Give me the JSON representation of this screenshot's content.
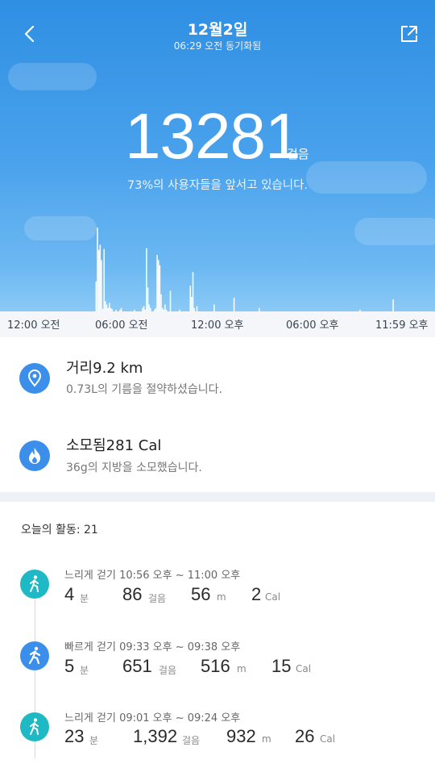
{
  "header": {
    "date": "12월2일",
    "sync_time": "06:29 오전 동기화됨"
  },
  "summary": {
    "steps": "13281",
    "steps_unit": "걸음",
    "rank_text": "73%의 사용자들을 앞서고 있습니다."
  },
  "chart_data": {
    "type": "bar",
    "x_range": [
      "12:00 오전",
      "11:59 오후"
    ],
    "tick_labels": [
      "12:00 오전",
      "06:00 오전",
      "12:00 오후",
      "06:00 오후",
      "11:59 오후"
    ],
    "ylim": [
      0,
      100
    ],
    "values": [
      0,
      0,
      0,
      0,
      0,
      0,
      0,
      0,
      0,
      0,
      0,
      0,
      0,
      0,
      0,
      0,
      0,
      0,
      0,
      0,
      0,
      0,
      0,
      0,
      0,
      0,
      0,
      0,
      0,
      0,
      0,
      0,
      0,
      0,
      0,
      0,
      0,
      0,
      0,
      0,
      0,
      0,
      0,
      0,
      0,
      0,
      0,
      0,
      0,
      0,
      0,
      0,
      0,
      0,
      0,
      0,
      0,
      0,
      0,
      0,
      0,
      0,
      0,
      0,
      0,
      0,
      0,
      0,
      0,
      0,
      0,
      0,
      35,
      98,
      72,
      78,
      60,
      3,
      73,
      12,
      8,
      4,
      10,
      4,
      3,
      0,
      0,
      2,
      0,
      0,
      2,
      4,
      0,
      0,
      0,
      0,
      0,
      0,
      0,
      0,
      0,
      2,
      0,
      0,
      0,
      0,
      0,
      4,
      6,
      2,
      74,
      28,
      8,
      4,
      0,
      0,
      2,
      4,
      66,
      60,
      54,
      20,
      4,
      2,
      8,
      2,
      0,
      0,
      24,
      0,
      0,
      0,
      0,
      0,
      0,
      2,
      0,
      0,
      0,
      0,
      0,
      0,
      0,
      30,
      17,
      46,
      4,
      0,
      6,
      0,
      0,
      0,
      0,
      0,
      0,
      0,
      0,
      0,
      0,
      0,
      0,
      8,
      0,
      0,
      0,
      0,
      0,
      0,
      0,
      0,
      0,
      0,
      0,
      0,
      0,
      0,
      16,
      0,
      0,
      0,
      0,
      0,
      0,
      0,
      0,
      0,
      0,
      0,
      0,
      0,
      0,
      0,
      0,
      0,
      0,
      4,
      0,
      0,
      0,
      0,
      0,
      0,
      0,
      0,
      0,
      0,
      0,
      0,
      0,
      0,
      0,
      0,
      0,
      0,
      0,
      0,
      0,
      0,
      0,
      0,
      0,
      0,
      0,
      0,
      0,
      0,
      0,
      0,
      0,
      0,
      0,
      0,
      0,
      0,
      0,
      0,
      0,
      0,
      0,
      0,
      0,
      0,
      0,
      0,
      0,
      0,
      0,
      0,
      0,
      0,
      0,
      0,
      0,
      0,
      0,
      0,
      0,
      0,
      0,
      0,
      0,
      0,
      0,
      0,
      0,
      0,
      0,
      0,
      0,
      0,
      0,
      2,
      0,
      0,
      0,
      0,
      0,
      0,
      0,
      0,
      0,
      0,
      0,
      0,
      0,
      0,
      0,
      0,
      0,
      0,
      0,
      0,
      0,
      0,
      0,
      0,
      14,
      0,
      0,
      0,
      0,
      0,
      0,
      0,
      0,
      0,
      0,
      0,
      0,
      0,
      0,
      0,
      0,
      0,
      0,
      0,
      0,
      0,
      0,
      0,
      0,
      0,
      0,
      0,
      0,
      0,
      0,
      0
    ]
  },
  "stats": [
    {
      "title": "거리9.2 km",
      "sub": "0.73L의 기름을 절약하셨습니다.",
      "icon": "location-icon"
    },
    {
      "title": "소모됨281 Cal",
      "sub": "36g의 지방을 소모했습니다.",
      "icon": "flame-icon"
    }
  ],
  "activities_title": "오늘의 활동:  21",
  "activities": [
    {
      "label": "느리게 걷기 10:56 오후 ~ 11:00 오후",
      "minutes": "4",
      "steps": "86",
      "meters": "56",
      "cal": "2",
      "icon_color": "#1fb8c5"
    },
    {
      "label": "빠르게 걷기 09:33 오후 ~ 09:38 오후",
      "minutes": "5",
      "steps": "651",
      "meters": "516",
      "cal": "15",
      "icon_color": "#3b8feb"
    },
    {
      "label": "느리게 걷기 09:01 오후 ~ 09:24 오후",
      "minutes": "23",
      "steps": "1,392",
      "meters": "932",
      "cal": "26",
      "icon_color": "#1fb8c5"
    }
  ],
  "units": {
    "min": "분",
    "steps": "걸음",
    "m": "m",
    "cal": "Cal"
  },
  "colors": {
    "accent": "#3b8feb",
    "slow_walk": "#1fb8c5"
  }
}
